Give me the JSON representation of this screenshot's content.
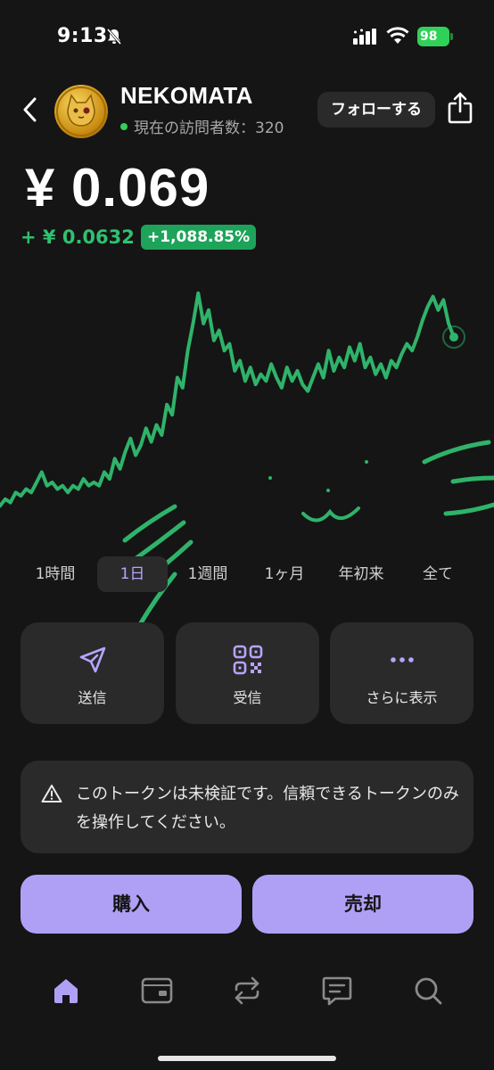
{
  "status_bar": {
    "time": "9:13",
    "battery": "98"
  },
  "header": {
    "token_name": "NEKOMATA",
    "visitors": "現在の訪問者数：320",
    "follow_label": "フォローする"
  },
  "price": {
    "value": "¥ 0.069",
    "change_abs": "+ ¥ 0.0632",
    "change_pct": "+1,088.85%"
  },
  "chart_data": {
    "type": "line",
    "line_color": "#2fb36a",
    "y": [
      0.012,
      0.014,
      0.013,
      0.016,
      0.015,
      0.017,
      0.016,
      0.019,
      0.022,
      0.018,
      0.019,
      0.017,
      0.018,
      0.016,
      0.018,
      0.017,
      0.02,
      0.018,
      0.019,
      0.018,
      0.022,
      0.02,
      0.026,
      0.023,
      0.028,
      0.032,
      0.027,
      0.03,
      0.035,
      0.031,
      0.036,
      0.033,
      0.042,
      0.039,
      0.05,
      0.047,
      0.058,
      0.066,
      0.075,
      0.066,
      0.07,
      0.061,
      0.064,
      0.058,
      0.06,
      0.052,
      0.055,
      0.049,
      0.053,
      0.048,
      0.051,
      0.049,
      0.054,
      0.05,
      0.047,
      0.053,
      0.049,
      0.052,
      0.048,
      0.046,
      0.05,
      0.054,
      0.05,
      0.058,
      0.052,
      0.056,
      0.053,
      0.059,
      0.055,
      0.06,
      0.053,
      0.056,
      0.051,
      0.054,
      0.05,
      0.055,
      0.053,
      0.057,
      0.06,
      0.058,
      0.062,
      0.067,
      0.071,
      0.074,
      0.07,
      0.073,
      0.066,
      0.062
    ]
  },
  "ranges": [
    {
      "label": "1時間",
      "active": false
    },
    {
      "label": "1日",
      "active": true
    },
    {
      "label": "1週間",
      "active": false
    },
    {
      "label": "1ヶ月",
      "active": false
    },
    {
      "label": "年初来",
      "active": false
    },
    {
      "label": "全て",
      "active": false
    }
  ],
  "actions": {
    "send": "送信",
    "receive": "受信",
    "more": "さらに表示"
  },
  "warning": {
    "text": "このトークンは未検証です。信頼できるトークンのみを操作してください。"
  },
  "trade": {
    "buy": "購入",
    "sell": "売却"
  },
  "colors": {
    "accent": "#b0a0f5",
    "positive": "#30c070",
    "background": "#151515",
    "card": "#2a2a2a"
  }
}
